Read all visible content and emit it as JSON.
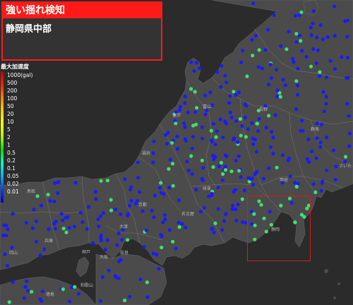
{
  "alert": {
    "title": "強い揺れ検知",
    "region": "静岡県中部"
  },
  "legend": {
    "title": "最大加速度",
    "scale_labels": [
      "1000(gal)",
      "500",
      "200",
      "100",
      "50",
      "20",
      "10",
      "5",
      "2",
      "1",
      "0.5",
      "0.2",
      "0.1",
      "0.05",
      "0.02",
      "0.01"
    ]
  },
  "map": {
    "place_labels": {
      "nagano": "長野",
      "fukui": "福井",
      "gifu": "岐阜",
      "shizuoka": "静岡",
      "nara": "奈良",
      "okayama": "岡山",
      "toyama": "富山",
      "ishikawa": "金沢",
      "gunma": "群馬",
      "kobe": "神戸",
      "saitama": "さいた",
      "kyoto": "京都",
      "tottori": "鳥取",
      "kofu": "甲府",
      "nagoya": "名古屋",
      "osaka": "大阪",
      "wakayama": "和歌山",
      "tokushima": "徳島",
      "hyogo": "兵庫",
      "otsu": "大津"
    }
  },
  "colors": {
    "alert_red": "#ff1a1a",
    "region_box": "#d02020",
    "station_blue": "#1a1aff",
    "station_green": "#40e070",
    "land": "#4b4b4b",
    "sea": "#2b2b2b"
  }
}
